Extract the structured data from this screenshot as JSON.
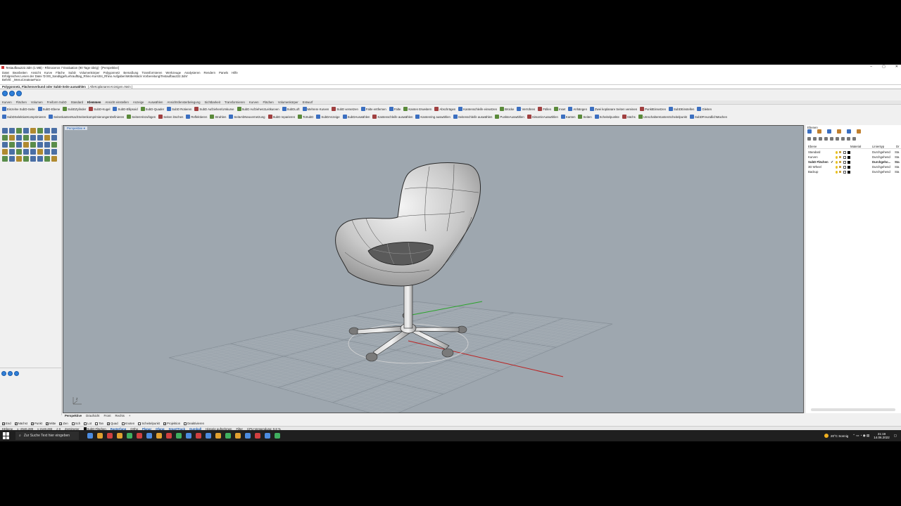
{
  "window": {
    "title": "Testaufbau222.3dm (1 MB) - Rhinoceros 7 Evaluation (90 Tage übrig) - [Perspektive]",
    "controls": [
      "–",
      "▢",
      "✕"
    ]
  },
  "menu": [
    "Datei",
    "Bearbeiten",
    "Ansicht",
    "Kurve",
    "Fläche",
    "SubD",
    "Volumenkörper",
    "Polygonnetz",
    "Bemaßung",
    "Transformieren",
    "Werkzeuge",
    "Analysieren",
    "Rendern",
    "Panels",
    "Hilfe"
  ],
  "command": {
    "history": [
      "Erfolgreiches Lesen der Datei 'D:\\00_Sandkjgel\\Lehraufttag_Rhino Kurs\\04_Rhino Aufgaben\\Möbelstück Vorbereitung\\Testaufbau222.3dm'",
      "Befehl: _MenuCreateaeFace"
    ],
    "prompt": "Polygonnetz, Flächenverbund oder SubD-Seite auswählen",
    "options": "( AlleKoplanarenAnzeigen=Nein )"
  },
  "tabs": [
    "Kurven",
    "Flächen",
    "Volumen",
    "Freiform SubD",
    "Standard",
    "Klemmen",
    "Ansicht einstellen",
    "Anzeige",
    "Auswählen",
    "Ansichtsfensterbelegung",
    "Sichtbarkeit",
    "Transformieren",
    "Kurven",
    "Flächen",
    "Volumenkörper",
    "Entwurf"
  ],
  "toolbar1": [
    "Einzelne SubD-Seite",
    "SubD-Ebene",
    "SubDZylinder",
    "SubD-Kugel",
    "SubD-Ellipsoid",
    "SubD-Quader",
    "SubD Rotieren",
    "SubD Aufziehen/Umkurve",
    "SubD Aufziehen2Leitkurven",
    "SubDLoft",
    "Mehrere Kurven",
    "SubD versetzen",
    "Falte entfernen",
    "Falte",
    "Kanten Erweitern",
    "Abschrägen",
    "Kantenschleife einsetzen",
    "Brücke",
    "Verrühren",
    "Füllen",
    "Inset",
    "Anhängen",
    "Zwei koplanare Seiten vereinen",
    "PunktEinsetzen",
    "SubDEinstellen",
    "Gleiten"
  ],
  "toolbar2": [
    "SubDSelektionKomprimieren",
    "SeitenkantenNachSeitenkomprimierungenDefinieren",
    "SeitenHinzufügen",
    "Seiten löschen",
    "Reflektieren",
    "Strahlen",
    "SeiteAbNeuvernetzung",
    "SubD reparieren",
    "ToSubD",
    "SubDAnzeige",
    "SubDAuswählen",
    "Kantenschleife auswählen",
    "Kantenring auswählen",
    "Seitenschleife auswählen",
    "PunkteAuswählen",
    "SimarrieAuswählen",
    "Kanten",
    "Seiten",
    "Scheitelpunkte",
    "Sächs",
    "UmschaltenKantenScheitelpunkt",
    "SubDFreundlichMachen"
  ],
  "viewport": {
    "title": "Perspektive",
    "axis_label": "z"
  },
  "layers": {
    "panel_title": "Ebenen",
    "headers": {
      "name": "Ebene",
      "material": "Material",
      "linetype": "Linientyp",
      "print": "Dr"
    },
    "rows": [
      {
        "name": "Standard",
        "current": false,
        "linetype": "Durchgehend",
        "print": "Sta"
      },
      {
        "name": "Kurven",
        "current": false,
        "linetype": "Durchgehend",
        "print": "Sta"
      },
      {
        "name": "SubD Flächen",
        "current": true,
        "linetype": "Durchgeho...",
        "print": "Sta"
      },
      {
        "name": "3D Wheel",
        "current": false,
        "linetype": "Durchgehend",
        "print": "Sta"
      },
      {
        "name": "Backup",
        "current": false,
        "linetype": "Durchgehend",
        "print": "Sta"
      }
    ]
  },
  "viewport_tabs": [
    "Perspektive",
    "Draufsicht",
    "Front",
    "Rechts",
    "+"
  ],
  "osnaps": [
    {
      "label": "End",
      "checked": true
    },
    {
      "label": "Nächst",
      "checked": true
    },
    {
      "label": "Punkt",
      "checked": true
    },
    {
      "label": "Mitte",
      "checked": true
    },
    {
      "label": "Zen",
      "checked": true
    },
    {
      "label": "Sch",
      "checked": false
    },
    {
      "label": "Lot",
      "checked": false
    },
    {
      "label": "Tan",
      "checked": false
    },
    {
      "label": "Quad",
      "checked": true
    },
    {
      "label": "Knoten",
      "checked": false
    },
    {
      "label": "Scheitelpunkt",
      "checked": false
    },
    {
      "label": "Projektion",
      "checked": true
    },
    {
      "label": "Deaktivieren",
      "checked": false
    }
  ],
  "status": {
    "cplane": "KEbene",
    "x": "x -2546.289",
    "y": "y 2148.283",
    "z": "z 0",
    "units": "Zentimeter",
    "layer": "SubD Flächen",
    "items": [
      {
        "label": "Rasterfang",
        "on": true
      },
      {
        "label": "Ortho",
        "on": false
      },
      {
        "label": "Planar",
        "on": true
      },
      {
        "label": "Ofang",
        "on": true
      },
      {
        "label": "SmartTrack",
        "on": true
      },
      {
        "label": "Gumball",
        "on": true
      },
      {
        "label": "Historie aufnehmen",
        "on": false
      },
      {
        "label": "Filter",
        "on": false
      },
      {
        "label": "CPU-Verwendung: 0.8 %",
        "on": false
      }
    ]
  },
  "taskbar": {
    "search_placeholder": "Zur Suche Text hier eingeben",
    "weather": "20°C Sonnig",
    "time": "21:19",
    "date": "14.06.2022"
  }
}
